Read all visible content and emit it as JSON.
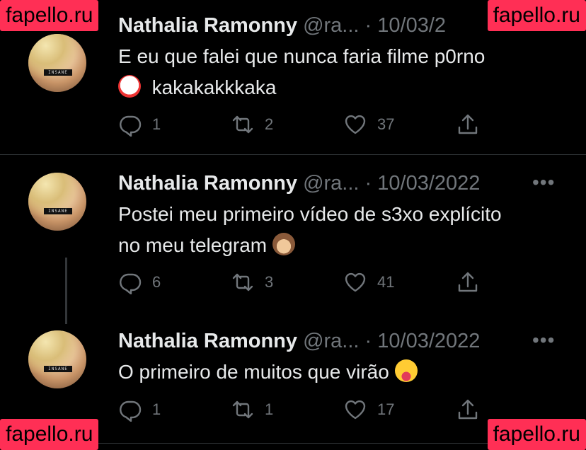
{
  "tweets": [
    {
      "name": "Nathalia Ramonny",
      "handle": "@ra...",
      "separator": "·",
      "date": "10/03/2",
      "text_line1": "E eu que falei que nunca faria filme p0rno",
      "text_line2": "kakakakkkaka",
      "emoji": "clown-face",
      "replies": "1",
      "retweets": "2",
      "likes": "37"
    },
    {
      "name": "Nathalia Ramonny",
      "handle": "@ra...",
      "separator": "·",
      "date": "10/03/2022",
      "text_line1": "Postei meu primeiro vídeo de s3xo explícito",
      "text_line2": "no meu telegram",
      "emoji": "see-no-evil-monkey",
      "replies": "6",
      "retweets": "3",
      "likes": "41"
    },
    {
      "name": "Nathalia Ramonny",
      "handle": "@ra...",
      "separator": "·",
      "date": "10/03/2022",
      "text_line1": "O primeiro de muitos que virão",
      "emoji": "face-with-tongue",
      "replies": "1",
      "retweets": "1",
      "likes": "17"
    }
  ],
  "more_label": "•••",
  "avatar_label": "INSANE",
  "watermark": "fapello.ru",
  "colors": {
    "background": "#000000",
    "text": "#e7e9ea",
    "muted": "#71767b",
    "watermark": "#ff2f55"
  }
}
